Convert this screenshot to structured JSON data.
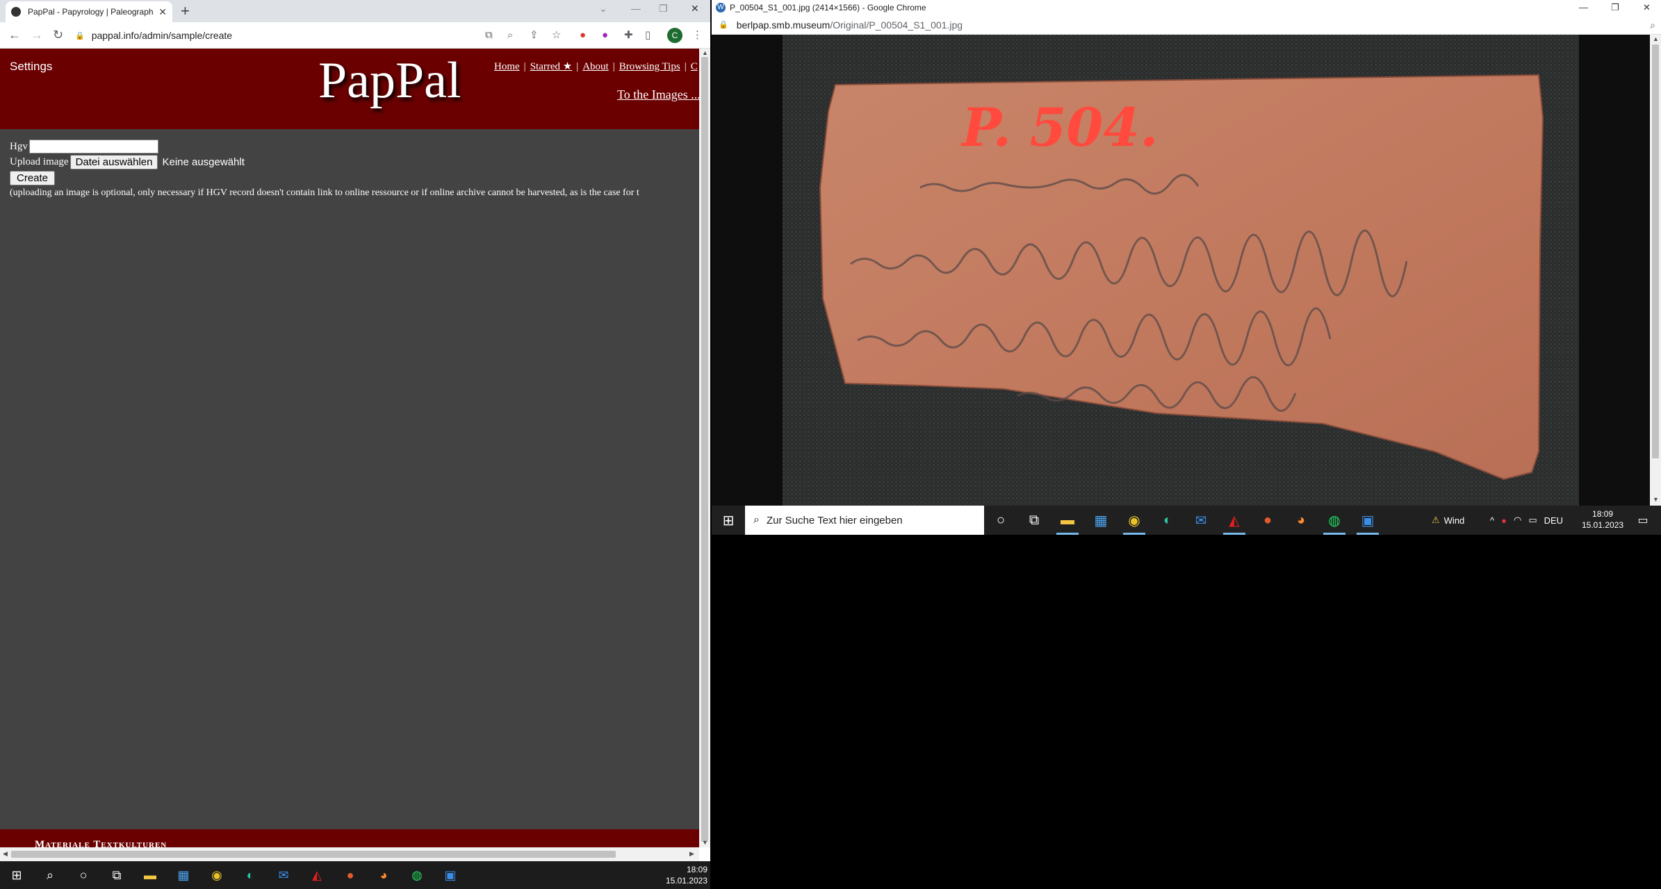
{
  "left_window": {
    "tab_title": "PapPal - Papyrology | Paleograph",
    "url": "pappal.info/admin/sample/create",
    "profile_initial": "C",
    "page": {
      "settings_label": "Settings",
      "brand": "PapPal",
      "nav": [
        "Home",
        "Starred ★",
        "About",
        "Browsing Tips",
        "C"
      ],
      "to_images": "To the Images ...",
      "hgv_label": "Hgv",
      "upload_label": "Upload image",
      "file_button": "Datei auswählen",
      "no_file": "Keine ausgewählt",
      "create_button": "Create",
      "note": "(uploading an image is optional, only necessary if HGV record doesn't contain link to online ressource or if online archive cannot be harvested, as is the case for t",
      "footer": "Materiale Textkulturen"
    }
  },
  "left_taskbar": {
    "items": [
      "windows-icon",
      "search-icon",
      "cortana-icon",
      "taskview-icon",
      "explorer-icon",
      "store-icon",
      "chrome-icon",
      "edge-icon",
      "mail-icon",
      "acrobat-icon",
      "powerpoint-icon",
      "firefox-icon",
      "spotify-icon",
      "photos-icon"
    ],
    "time": "18:09",
    "date": "15.01.2023"
  },
  "right_window": {
    "title": "P_00504_S1_001.jpg (2414×1566) - Google Chrome",
    "url_host": "berlpap.smb.museum",
    "url_path": "/Original/P_00504_S1_001.jpg",
    "ostracon_label": "P. 504."
  },
  "right_taskbar": {
    "search_placeholder": "Zur Suche Text hier eingeben",
    "weather": "Wind",
    "lang": "DEU",
    "time": "18:09",
    "date": "15.01.2023"
  },
  "colors": {
    "banner": "#6b0000",
    "page_bg": "#434343",
    "ostracon": "#c47a5e",
    "ink_red": "#ff4a3d"
  }
}
